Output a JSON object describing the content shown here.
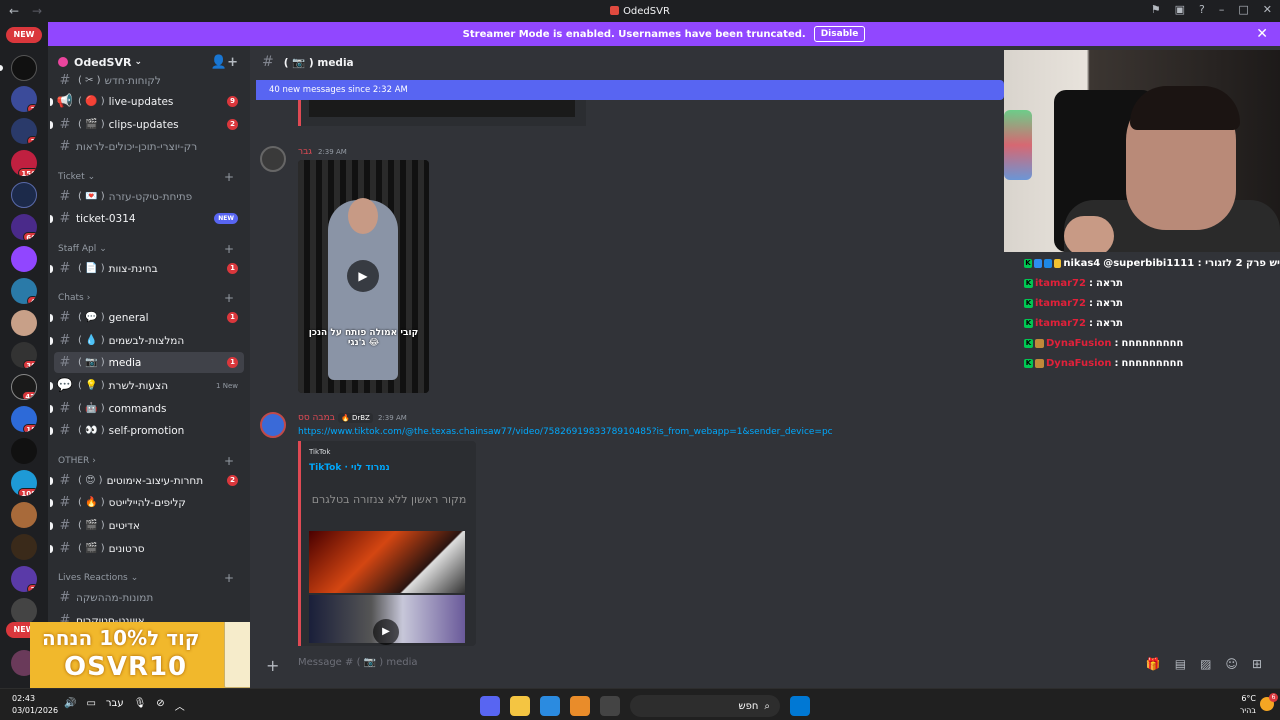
{
  "window": {
    "title": "OdedSVR"
  },
  "banner": {
    "text": "Streamer Mode is enabled. Usernames have been truncated.",
    "disable_label": "Disable"
  },
  "rail": {
    "new_label": "NEW",
    "badges": [
      "2",
      "2",
      "156",
      "66",
      "4",
      "30",
      "43",
      "18",
      "108",
      "2"
    ]
  },
  "sidebar": {
    "server_name": "OdedSVR",
    "categories": {
      "ticket": "Ticket",
      "staff": "Staff Apl",
      "chats": "Chats",
      "other": "OTHER",
      "lives": "Lives Reactions"
    },
    "channels": {
      "top_partial": "לקוחות·חדש",
      "live_updates": {
        "emoji": "( 🔴 )",
        "name": "live-updates",
        "badge": "9"
      },
      "clips_updates": {
        "emoji": "( 🎬 )",
        "name": "clips-updates",
        "badge": "2"
      },
      "creators": {
        "name": "רק-יוצרי-תוכן-יכולים-לראות"
      },
      "open_ticket": {
        "emoji": "( 💌 )",
        "name": "פתיחת-טיקט-עזרה"
      },
      "ticket": {
        "name": "ticket-0314",
        "badge": "NEW"
      },
      "team": {
        "emoji": "( 📄 )",
        "name": "בחינת-צוות",
        "badge": "1"
      },
      "general": {
        "emoji": "( 💬 )",
        "name": "general",
        "badge": "1"
      },
      "recommend": {
        "emoji": "( 💧 )",
        "name": "המלצות-לבשמים"
      },
      "media": {
        "emoji": "( 📷 )",
        "name": "media",
        "badge": "1"
      },
      "suggest": {
        "emoji": "( 💡 )",
        "name": "הצעות-לשרת",
        "badge": "1 New"
      },
      "commands": {
        "emoji": "( 🤖 )",
        "name": "commands"
      },
      "promo": {
        "emoji": "( 👀 )",
        "name": "self-promotion"
      },
      "emoji_design": {
        "emoji": "( 😍 )",
        "name": "תחרות-עיצוב-אימוטים",
        "badge": "2"
      },
      "highlights": {
        "emoji": "( 🔥 )",
        "name": "קליפים-להיילייטס"
      },
      "edits": {
        "emoji": "( 🎬 )",
        "name": "אדיטים"
      },
      "movies": {
        "emoji": "( 🎬 )",
        "name": "סרטונים"
      },
      "pics": {
        "name": "תמונות-מההשקה"
      },
      "stickers": {
        "name": "איוונט-סטיקרים"
      }
    }
  },
  "promo_overlay": {
    "line1": "קוד ל10% הנחה",
    "line2": "OSVR10"
  },
  "chat": {
    "header": "( 📷 )  media",
    "new_messages": "40 new messages since 2:32 AM",
    "msg1": {
      "user": "גבר",
      "time": "2:39 AM",
      "caption": "קובי אמולה פותח על הנכן ג'נגי 😂"
    },
    "msg2": {
      "user": "במבה סס",
      "tag": "🔥 DrBZ",
      "time": "2:39 AM",
      "link": "https://www.tiktok.com/@the.texas.chainsaw77/video/7582691983378910485?is_from_webapp=1&sender_device=pc",
      "embed_provider": "TikTok",
      "embed_title": "TikTok · נמרוד לוי",
      "embed_header": "מקור ראשון ללא צנזורה בטלגרם"
    },
    "composer_placeholder": "Message # ( 📷 )  media"
  },
  "twitch_chat": [
    {
      "user": "nikas4",
      "color": "#ffffff",
      "text": "@superbibi1111 : יש פרק 2 לזגורי"
    },
    {
      "user": "itamar72",
      "color": "#e0213a",
      "text": "תראה"
    },
    {
      "user": "itamar72",
      "color": "#e0213a",
      "text": "תראה"
    },
    {
      "user": "itamar72",
      "color": "#e0213a",
      "text": "תראה"
    },
    {
      "user": "DynaFusion",
      "color": "#e0213a",
      "text": "חחחחחחחחח"
    },
    {
      "user": "DynaFusion",
      "color": "#e0213a",
      "text": "חחחחחחחחח"
    }
  ],
  "taskbar": {
    "time": "02:43",
    "date": "03/01/2026",
    "lang": "עבר",
    "search": "חפש",
    "temp": "6°C",
    "weather": "בהיר",
    "weather_badge": "6"
  }
}
